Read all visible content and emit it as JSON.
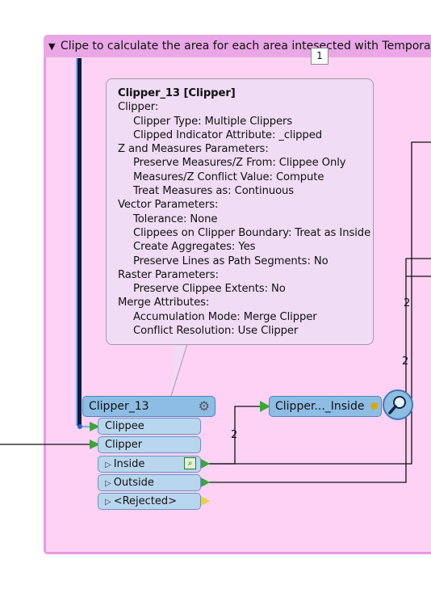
{
  "bookmark": {
    "title": "Clipe to calculate the area for each area intesected with Temporary",
    "collapse_glyph": "▼",
    "badge": "1"
  },
  "tooltip": {
    "title": "Clipper_13 [Clipper]",
    "lines": [
      {
        "text": "Clipper:",
        "level": 1
      },
      {
        "text": "Clipper Type: Multiple Clippers",
        "level": 2
      },
      {
        "text": "Clipped Indicator Attribute: _clipped",
        "level": 2
      },
      {
        "text": "Z and Measures Parameters:",
        "level": 1
      },
      {
        "text": "Preserve Measures/Z From: Clippee Only",
        "level": 2
      },
      {
        "text": "Measures/Z Conflict Value: Compute",
        "level": 2
      },
      {
        "text": "Treat Measures as: Continuous",
        "level": 2
      },
      {
        "text": "Vector Parameters:",
        "level": 1
      },
      {
        "text": "Tolerance: None",
        "level": 2
      },
      {
        "text": "Clippees on Clipper Boundary: Treat as Inside",
        "level": 2
      },
      {
        "text": "Create Aggregates: Yes",
        "level": 2
      },
      {
        "text": "Preserve Lines as Path Segments: No",
        "level": 2
      },
      {
        "text": "Raster Parameters:",
        "level": 1
      },
      {
        "text": "Preserve Clippee Extents: No",
        "level": 2
      },
      {
        "text": "Merge Attributes:",
        "level": 1
      },
      {
        "text": "Accumulation Mode: Merge Clipper",
        "level": 2
      },
      {
        "text": "Conflict Resolution: Use Clipper",
        "level": 2
      }
    ]
  },
  "transformer": {
    "name": "Clipper_13",
    "gear_icon": "gear-icon",
    "inputs": [
      "Clippee",
      "Clipper"
    ],
    "outputs": [
      "Inside",
      "Outside",
      "<Rejected>"
    ],
    "output_arrow": "▷"
  },
  "inspector": {
    "name": "Clipper..._Inside",
    "icon": "magnifier-icon"
  },
  "counts": {
    "inside_to_inspector": "2",
    "right_upper": "2",
    "right_lower": "2"
  },
  "colors": {
    "bookmark_fill": "#fdd2f5",
    "bookmark_header": "#e9a7e6",
    "transformer_fill": "#8ebde4",
    "port_fill": "#b9d6ef",
    "tooltip_fill": "#f0dcf5",
    "port_green": "#3aa63a",
    "port_yellow": "#e8d23a"
  }
}
